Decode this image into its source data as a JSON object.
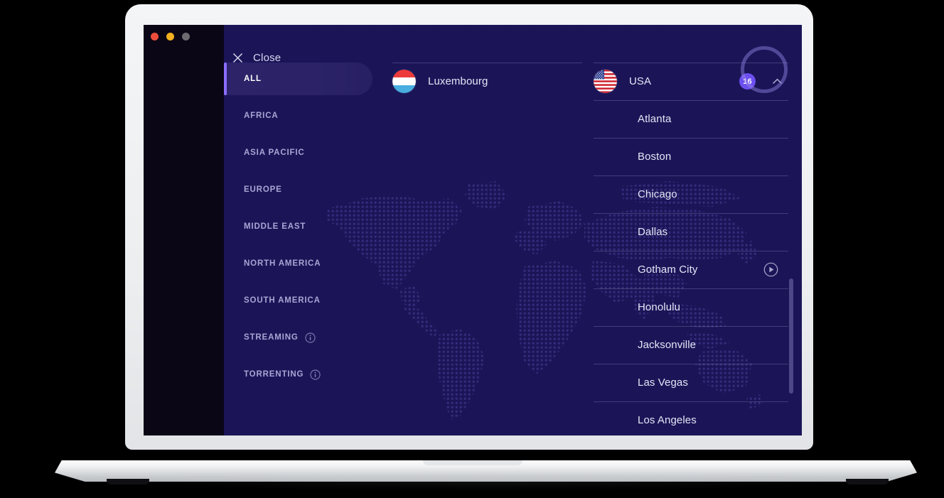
{
  "window": {
    "traffic_lights": [
      "close-red",
      "minimize-yellow",
      "zoom-gray"
    ]
  },
  "header": {
    "close_label": "Close",
    "close_icon": "x-icon"
  },
  "sidebar": {
    "items": [
      {
        "label": "ALL",
        "active": true,
        "info": false
      },
      {
        "label": "AFRICA",
        "active": false,
        "info": false
      },
      {
        "label": "ASIA PACIFIC",
        "active": false,
        "info": false
      },
      {
        "label": "EUROPE",
        "active": false,
        "info": false
      },
      {
        "label": "MIDDLE EAST",
        "active": false,
        "info": false
      },
      {
        "label": "NORTH AMERICA",
        "active": false,
        "info": false
      },
      {
        "label": "SOUTH AMERICA",
        "active": false,
        "info": false
      },
      {
        "label": "STREAMING",
        "active": false,
        "info": true
      },
      {
        "label": "TORRENTING",
        "active": false,
        "info": true
      }
    ],
    "info_icon": "info-icon"
  },
  "country_column": {
    "items": [
      {
        "name": "Luxembourg",
        "flag": "luxembourg-flag"
      }
    ]
  },
  "server_column": {
    "country": {
      "name": "USA",
      "flag": "usa-flag",
      "count_badge": "16",
      "expand_icon": "chevron-up-icon",
      "expanded": true
    },
    "cities": [
      {
        "name": "Atlanta",
        "action": null
      },
      {
        "name": "Boston",
        "action": null
      },
      {
        "name": "Chicago",
        "action": null
      },
      {
        "name": "Dallas",
        "action": null
      },
      {
        "name": "Gotham City",
        "action": "play-icon"
      },
      {
        "name": "Honolulu",
        "action": null
      },
      {
        "name": "Jacksonville",
        "action": null
      },
      {
        "name": "Las Vegas",
        "action": null
      },
      {
        "name": "Los Angeles",
        "action": null
      }
    ]
  },
  "colors": {
    "background": "#1b1558",
    "rail": "#0a0616",
    "accent": "#8b6dff",
    "badge": "#6c4ff0",
    "active_pill": "#2c2369",
    "text": "#e6e5f5",
    "muted_text": "#a9a5d2"
  }
}
